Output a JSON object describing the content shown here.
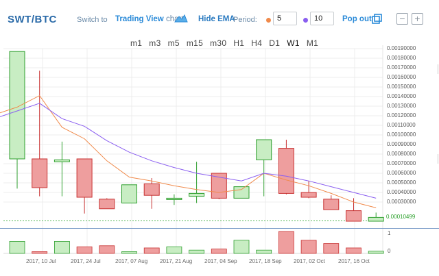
{
  "header": {
    "pair": "SWT/BTC",
    "switch_text": "Switch to",
    "switch_link": "Trading View",
    "switch_suffix": "chart",
    "hide_ema": "Hide EMA",
    "period_label": "Period:",
    "ema_fast": "5",
    "ema_slow": "10",
    "pop_out": "Pop out",
    "minus": "−",
    "plus": "+"
  },
  "timeframes": [
    "m1",
    "m3",
    "m5",
    "m15",
    "m30",
    "H1",
    "H4",
    "D1",
    "W1",
    "M1"
  ],
  "active_timeframe": "W1",
  "current_price": "0.00010499",
  "volume_axis": [
    "1",
    "0"
  ],
  "colors": {
    "up": "#2e9e2e",
    "up_fill": "#c8edc3",
    "down": "#c83232",
    "down_fill": "#ee9e9e",
    "ema_fast": "#f08a4b",
    "ema_slow": "#8a5ef0",
    "link": "#2a8ad8"
  },
  "chart_data": {
    "type": "candlestick",
    "y_tick_labels": [
      "0.00190000",
      "0.00180000",
      "0.00170000",
      "0.00160000",
      "0.00150000",
      "0.00140000",
      "0.00130000",
      "0.00120000",
      "0.00110000",
      "0.00100000",
      "0.00090000",
      "0.00080000",
      "0.00070000",
      "0.00060000",
      "0.00050000",
      "0.00040000",
      "0.00030000"
    ],
    "x_tick_labels": [
      "2017, 10 Jul",
      "2017, 24 Jul",
      "2017, 07 Aug",
      "2017, 21 Aug",
      "2017, 04 Sep",
      "2017, 18 Sep",
      "2017, 02 Oct",
      "2017, 16 Oct"
    ],
    "ylim": [
      0.0001,
      0.00195
    ],
    "candles": [
      {
        "open": 0.00075,
        "high": 0.00187,
        "low": 0.00044,
        "close": 0.00187,
        "vol": 0.55
      },
      {
        "open": 0.00075,
        "high": 0.00167,
        "low": 0.00036,
        "close": 0.00045,
        "vol": 0.08
      },
      {
        "open": 0.00072,
        "high": 0.00093,
        "low": 0.00036,
        "close": 0.00074,
        "vol": 0.55
      },
      {
        "open": 0.00075,
        "high": 0.00075,
        "low": 0.00018,
        "close": 0.00035,
        "vol": 0.3
      },
      {
        "open": 0.00033,
        "high": 0.00034,
        "low": 0.00023,
        "close": 0.00023,
        "vol": 0.35
      },
      {
        "open": 0.00029,
        "high": 0.00048,
        "low": 0.00029,
        "close": 0.00048,
        "vol": 0.08
      },
      {
        "open": 0.00049,
        "high": 0.00055,
        "low": 0.00023,
        "close": 0.00037,
        "vol": 0.25
      },
      {
        "open": 0.00034,
        "high": 0.00038,
        "low": 0.00027,
        "close": 0.00034,
        "vol": 0.3
      },
      {
        "open": 0.00036,
        "high": 0.00072,
        "low": 0.00029,
        "close": 0.00039,
        "vol": 0.15
      },
      {
        "open": 0.0006,
        "high": 0.0006,
        "low": 0.00033,
        "close": 0.00034,
        "vol": 0.2
      },
      {
        "open": 0.00034,
        "high": 0.00046,
        "low": 0.00034,
        "close": 0.00046,
        "vol": 0.6
      },
      {
        "open": 0.00074,
        "high": 0.00095,
        "low": 0.00036,
        "close": 0.00095,
        "vol": 0.15
      },
      {
        "open": 0.00086,
        "high": 0.00095,
        "low": 0.00038,
        "close": 0.00039,
        "vol": 1.0
      },
      {
        "open": 0.0004,
        "high": 0.00052,
        "low": 0.00034,
        "close": 0.00035,
        "vol": 0.6
      },
      {
        "open": 0.00033,
        "high": 0.00037,
        "low": 0.00022,
        "close": 0.00022,
        "vol": 0.45
      },
      {
        "open": 0.00021,
        "high": 0.00034,
        "low": 0.0001,
        "close": 0.0001,
        "vol": 0.25
      },
      {
        "open": 0.0001,
        "high": 0.00019,
        "low": 0.0001,
        "close": 0.00014,
        "vol": 0.1
      }
    ],
    "ema_fast": [
      0.00129,
      0.00141,
      0.00108,
      0.00096,
      0.00073,
      0.00056,
      0.00052,
      0.00047,
      0.00043,
      0.0004,
      0.00043,
      0.0006,
      0.00053,
      0.00047,
      0.00039,
      0.0003,
      0.00024
    ],
    "ema_slow": [
      0.00125,
      0.00133,
      0.00117,
      0.00109,
      0.00094,
      0.00082,
      0.00073,
      0.00066,
      0.0006,
      0.00056,
      0.00052,
      0.0006,
      0.00057,
      0.00052,
      0.00046,
      0.0004,
      0.00034
    ]
  }
}
